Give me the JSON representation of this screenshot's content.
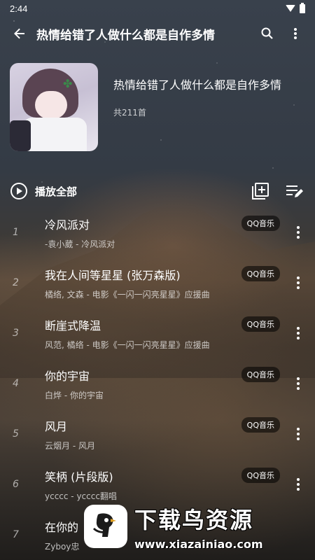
{
  "status_bar": {
    "time": "2:44"
  },
  "toolbar": {
    "title": "热情给错了人做什么都是自作多情",
    "back_icon": "arrow-back-icon",
    "search_icon": "search-icon",
    "more_icon": "more-vert-icon"
  },
  "playlist": {
    "title": "热情给错了人做什么都是自作多情",
    "count": "共211首"
  },
  "play_all": {
    "label": "播放全部",
    "add_icon": "add-to-queue-icon",
    "edit_icon": "playlist-edit-icon"
  },
  "songs": [
    {
      "num": "1",
      "title": "冷风派对",
      "sub": "-袁小葳 - 冷风派对",
      "badge": "QQ音乐"
    },
    {
      "num": "2",
      "title": "我在人间等星星 (张万森版)",
      "sub": "橘络, 文森 - 电影《一闪一闪亮星星》应援曲",
      "badge": "QQ音乐"
    },
    {
      "num": "3",
      "title": "断崖式降温",
      "sub": "风范, 橘络 - 电影《一闪一闪亮星星》应援曲",
      "badge": "QQ音乐"
    },
    {
      "num": "4",
      "title": "你的宇宙",
      "sub": "白烨 - 你的宇宙",
      "badge": "QQ音乐"
    },
    {
      "num": "5",
      "title": "风月",
      "sub": "云烟月 - 风月",
      "badge": "QQ音乐"
    },
    {
      "num": "6",
      "title": "笑柄 (片段版)",
      "sub": "ycccc - ycccc翻唱",
      "badge": "QQ音乐"
    },
    {
      "num": "7",
      "title": "在你的",
      "sub": "Zyboy忠",
      "badge": ""
    }
  ],
  "watermark": {
    "title": "下载鸟资源",
    "url": "www.xiazainiao.com"
  }
}
